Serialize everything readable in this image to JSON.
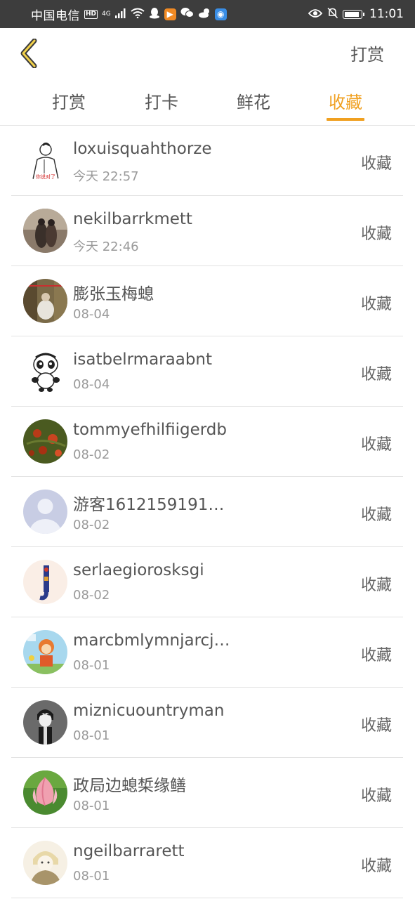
{
  "status_bar": {
    "carrier": "中国电信",
    "hd_badge": "HD",
    "network": "4G",
    "time": "11:01"
  },
  "header": {
    "back_icon": "chevron-left-icon",
    "action_label": "打赏"
  },
  "tabs": [
    {
      "label": "打赏",
      "active": false
    },
    {
      "label": "打卡",
      "active": false
    },
    {
      "label": "鲜花",
      "active": false
    },
    {
      "label": "收藏",
      "active": true
    }
  ],
  "colors": {
    "accent": "#f0a020",
    "text_primary": "#555555",
    "text_secondary": "#9a9a9a",
    "status_bar": "#3d3d3d"
  },
  "items": [
    {
      "name": "loxuisquahthorze",
      "time": "今天 22:57",
      "action": "收藏"
    },
    {
      "name": "nekilbarrkmett",
      "time": "今天 22:46",
      "action": "收藏"
    },
    {
      "name": "膨张玉梅螅",
      "time": "08-04",
      "action": "收藏"
    },
    {
      "name": "isatbelrmaraabnt",
      "time": "08-04",
      "action": "收藏"
    },
    {
      "name": "tommyefhilfiigerdb",
      "time": "08-02",
      "action": "收藏"
    },
    {
      "name": "游客1612159191…",
      "time": "08-02",
      "action": "收藏"
    },
    {
      "name": "serlaegiorosksgi",
      "time": "08-02",
      "action": "收藏"
    },
    {
      "name": "marcbmlymnjarcj…",
      "time": "08-01",
      "action": "收藏"
    },
    {
      "name": "miznicuountryman",
      "time": "08-01",
      "action": "收藏"
    },
    {
      "name": "政局边螅椞缘鳝",
      "time": "08-01",
      "action": "收藏"
    },
    {
      "name": "ngeilbarrarett",
      "time": "08-01",
      "action": "收藏"
    }
  ]
}
